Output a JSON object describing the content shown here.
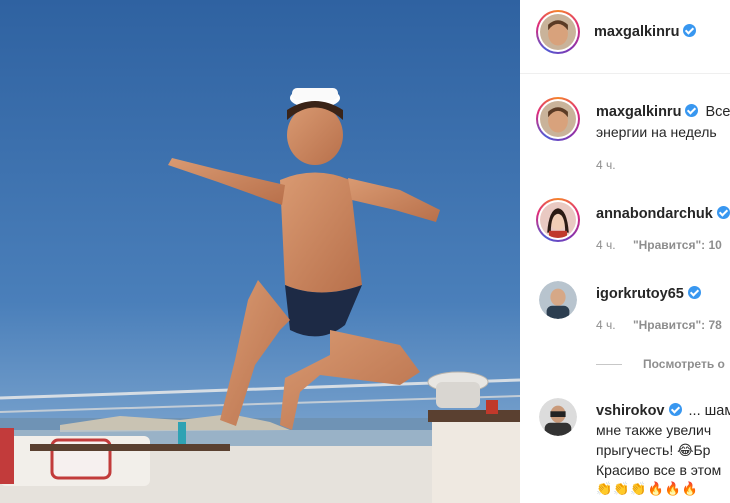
{
  "post_author": {
    "username": "maxgalkinru",
    "verified": true
  },
  "comments": [
    {
      "username": "maxgalkinru",
      "verified": true,
      "text_lines": [
        "Все",
        "энергии на недель"
      ],
      "time": "4 ч.",
      "likes": ""
    },
    {
      "username": "annabondarchuk",
      "verified": true,
      "text_lines": [],
      "time": "4 ч.",
      "likes": "\"Нравится\": 10"
    },
    {
      "username": "igorkrutoy65",
      "verified": true,
      "text_lines": [],
      "time": "4 ч.",
      "likes": "\"Нравится\": 78"
    },
    {
      "username": "vshirokov",
      "verified": true,
      "text_lines": [
        "... шам",
        "мне также увелич",
        "прыгучесть! 😂Бр",
        "Красиво все в этом"
      ],
      "emojis": "👏👏👏🔥🔥🔥",
      "time": "",
      "likes": ""
    }
  ],
  "view_replies": "Посмотреть о",
  "colors": {
    "sky": "#3d6fa8",
    "verified": "#3897f0",
    "meta": "#8e8e8e"
  },
  "icons": [
    "verified-badge-icon"
  ]
}
